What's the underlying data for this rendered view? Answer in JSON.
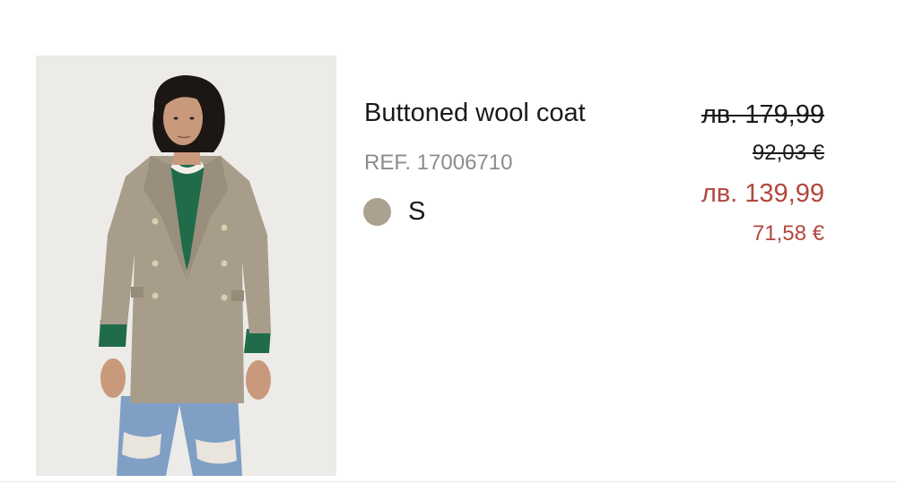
{
  "product": {
    "title": "Buttoned wool coat",
    "reference": "REF. 17006710",
    "color_swatch": "#aca091",
    "size": "S",
    "image_icon": "product-photo-woman-in-coat"
  },
  "pricing": {
    "original_bgn": "лв. 179,99",
    "original_eur": "92,03 €",
    "sale_bgn": "лв. 139,99",
    "sale_eur": "71,58 €",
    "sale_color": "#b3473f"
  }
}
